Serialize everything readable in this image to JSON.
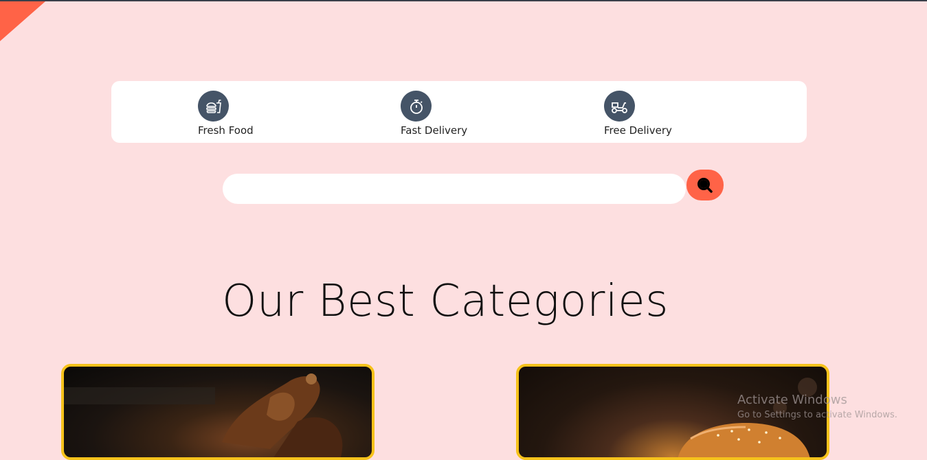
{
  "features": [
    {
      "label": "Fresh Food",
      "icon": "fast-food-icon"
    },
    {
      "label": "Fast Delivery",
      "icon": "stopwatch-icon"
    },
    {
      "label": "Free Delivery",
      "icon": "scooter-icon"
    }
  ],
  "search": {
    "placeholder": "",
    "value": ""
  },
  "section": {
    "title": "Our Best Categories"
  },
  "categories": [
    {
      "image": "grilled-chicken-image"
    },
    {
      "image": "burger-image"
    }
  ],
  "watermark": {
    "line1": "Activate Windows",
    "line2": "Go to Settings to activate Windows."
  },
  "colors": {
    "background": "#fddfe0",
    "accent": "#ff6347",
    "icon_circle": "#455467",
    "card_border": "#f6c21b"
  }
}
